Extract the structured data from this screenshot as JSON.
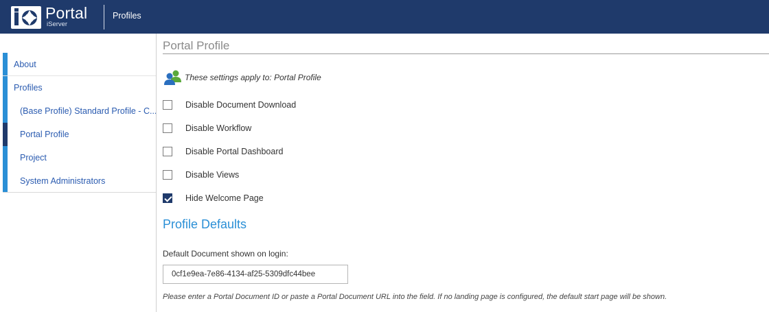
{
  "header": {
    "logo_title": "Portal",
    "logo_subtitle": "iServer",
    "section": "Profiles"
  },
  "sidebar": {
    "items": [
      {
        "label": "About"
      },
      {
        "label": "Profiles"
      },
      {
        "label": "(Base Profile) Standard Profile - C..."
      },
      {
        "label": "Portal Profile"
      },
      {
        "label": "Project"
      },
      {
        "label": "System Administrators"
      }
    ]
  },
  "main": {
    "title": "Portal Profile",
    "applies_text": "These settings apply to: Portal Profile",
    "options": [
      {
        "label": "Disable Document Download",
        "checked": false
      },
      {
        "label": "Disable Workflow",
        "checked": false
      },
      {
        "label": "Disable Portal Dashboard",
        "checked": false
      },
      {
        "label": "Disable Views",
        "checked": false
      },
      {
        "label": "Hide Welcome Page",
        "checked": true
      }
    ],
    "defaults_title": "Profile Defaults",
    "default_doc_label": "Default Document shown on login:",
    "default_doc_value": "0cf1e9ea-7e86-4134-af25-5309dfc44bee",
    "help_text": "Please enter a Portal Document ID or paste a Portal Document URL into the field. If no landing page is configured, the default start page will be shown."
  },
  "icons": {
    "logo": "io-logo-icon",
    "users": "users-icon",
    "checkbox_checked": "checkmark-icon"
  },
  "colors": {
    "header_bg": "#1f3a6b",
    "accent": "#2a8fd6",
    "nav_text": "#2a5bb0"
  }
}
